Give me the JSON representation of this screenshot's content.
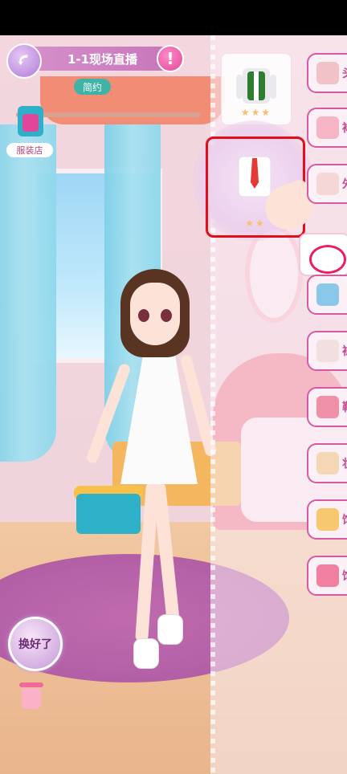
{
  "header": {
    "level_title": "1-1现场直播",
    "style_tag": "简约",
    "info_symbol": "!"
  },
  "sidebar_left": {
    "shop_label": "服装店"
  },
  "bottom": {
    "done_button_label": "换好了"
  },
  "right_panel": {
    "items": [
      {
        "name": "green-vest-outfit",
        "stars": "★★★"
      },
      {
        "name": "white-shirt-red-tie",
        "stars": "★★"
      }
    ],
    "categories": [
      {
        "key": "hair",
        "label": "头",
        "icon_color": "#f2c2c9"
      },
      {
        "key": "dress",
        "label": "裙",
        "icon_color": "#f7b6c6"
      },
      {
        "key": "outerwear",
        "label": "外",
        "icon_color": "#f5d7d7"
      },
      {
        "key": "skirt",
        "label": "",
        "icon_color": "#8bc7e8"
      },
      {
        "key": "socks",
        "label": "袜",
        "icon_color": "#f2e0e0"
      },
      {
        "key": "shoes",
        "label": "鞋",
        "icon_color": "#f08fa8"
      },
      {
        "key": "makeup",
        "label": "妆",
        "icon_color": "#f6d7b5"
      },
      {
        "key": "hat",
        "label": "饰",
        "icon_color": "#f7c86e"
      },
      {
        "key": "accessory",
        "label": "饰",
        "icon_color": "#f07fa0"
      }
    ]
  },
  "colors": {
    "accent_pink": "#d65aa3",
    "highlight_red": "#e20e1c",
    "style_tag_teal": "#3fb4a6"
  }
}
